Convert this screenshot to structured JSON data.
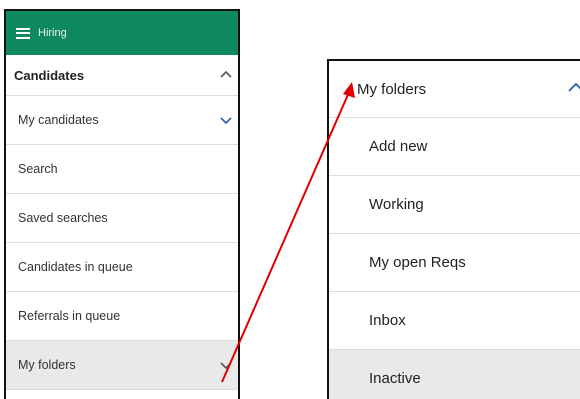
{
  "left": {
    "header_title": "Hiring",
    "items": [
      {
        "label": "Candidates"
      },
      {
        "label": "My candidates"
      },
      {
        "label": "Search"
      },
      {
        "label": "Saved searches"
      },
      {
        "label": "Candidates in queue"
      },
      {
        "label": "Referrals in queue"
      },
      {
        "label": "My folders"
      }
    ]
  },
  "right": {
    "items": [
      {
        "label": "My folders"
      },
      {
        "label": "Add new"
      },
      {
        "label": "Working"
      },
      {
        "label": "My open Reqs"
      },
      {
        "label": "Inbox"
      },
      {
        "label": "Inactive"
      }
    ]
  },
  "colors": {
    "header_green": "#0f8a5f",
    "arrow_red": "#e00000",
    "selected_row": "#e9e9e9",
    "chevron_blue": "#2a5fa8"
  }
}
